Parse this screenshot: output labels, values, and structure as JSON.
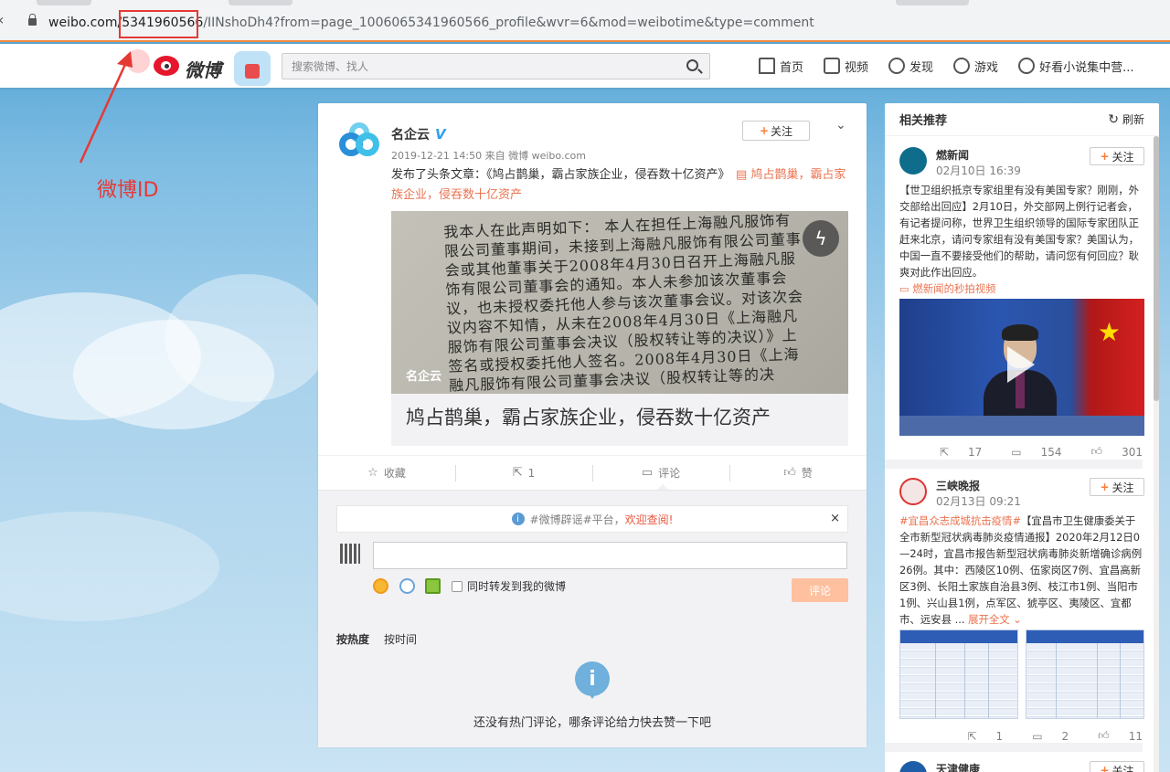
{
  "browser": {
    "url_host": "weibo.com/",
    "url_id": "5341960566",
    "url_rest": "/IINshoDh4?from=page_1006065341960566_profile&wvr=6&mod=weibotime&type=comment"
  },
  "annotation": {
    "label": "微博ID",
    "color": "#e53935"
  },
  "nav": {
    "logo_text": "微博",
    "search_placeholder": "搜索微博、找人",
    "items": [
      {
        "label": "首页",
        "icon": "home-icon"
      },
      {
        "label": "视频",
        "icon": "video-icon"
      },
      {
        "label": "发现",
        "icon": "compass-icon"
      },
      {
        "label": "游戏",
        "icon": "gamepad-icon"
      },
      {
        "label": "好看小说集中营...",
        "icon": "user-icon"
      }
    ]
  },
  "post": {
    "author": "名企云",
    "verified_badge": "V",
    "time_source": "2019-12-21 14:50 来自 微博 weibo.com",
    "follow_label": "关注",
    "text": "发布了头条文章：《鸠占鹊巢，霸占家族企业，侵吞数十亿资产》",
    "link_text": "鸠占鹊巢，霸占家族企业，侵吞数十亿资产",
    "image_doc_text": "我本人在此声明如下：\n本人在担任上海融凡服饰有限公司董事期间，未接到上海融凡服饰有限公司董事会或其他董事关于2008年4月30日召开上海融凡服饰有限公司董事会的通知。本人未参加该次董事会议，也未授权委托他人参与该次董事会议。对该次会议内容不知情，从未在2008年4月30日《上海融凡服饰有限公司董事会决议（股权转让等的决议）》上签名或授权委托他人签名。2008年4月30日《上海融凡服饰有限公司董事会决议（股权转让等的决",
    "image_brand": "名企云",
    "article_title": "鸠占鹊巢，霸占家族企业，侵吞数十亿资产",
    "actions": [
      {
        "label": "收藏",
        "icon": "star-icon"
      },
      {
        "label": "1",
        "icon": "share-icon"
      },
      {
        "label": "评论",
        "icon": "comment-icon"
      },
      {
        "label": "赞",
        "icon": "like-icon"
      }
    ]
  },
  "comments": {
    "rumor_prefix": "#微博辟谣#平台，",
    "rumor_link": "欢迎查阅!",
    "close": "×",
    "input_value": "",
    "forward_label": "同时转发到我的微博",
    "submit_label": "评论",
    "sort": [
      "按热度",
      "按时间"
    ],
    "empty_text": "还没有热门评论，哪条评论给力快去赞一下吧"
  },
  "sidebar": {
    "title": "相关推荐",
    "refresh_label": "刷新",
    "feeds": [
      {
        "name": "燃新闻",
        "time": "02月10日 16:39",
        "follow": "关注",
        "text": "【世卫组织抵京专家组里有没有美国专家？刚刚，外交部给出回应】2月10日，外交部网上例行记者会，有记者提问称，世界卫生组织领导的国际专家团队正赶来北京，请问专家组有没有美国专家？美国认为，中国一直不要接受他们的帮助，请问您有何回应？耿爽对此作出回应。",
        "video_link": "燃新闻的秒拍视频",
        "reposts": "17",
        "comments": "154",
        "likes": "301"
      },
      {
        "name": "三峡晚报",
        "time": "02月13日 09:21",
        "follow": "关注",
        "hashtag": "#宜昌众志成城抗击疫情#",
        "text": "【宜昌市卫生健康委关于全市新型冠状病毒肺炎疫情通报】2020年2月12日0—24时，宜昌市报告新型冠状病毒肺炎新增确诊病例26例。其中：西陵区10例、伍家岗区7例、宜昌高新区3例、长阳土家族自治县3例、枝江市1例、当阳市1例、兴山县1例，点军区、猇亭区、夷陵区、宜都市、远安县 ...",
        "expand": "展开全文",
        "reposts": "1",
        "comments": "2",
        "likes": "11"
      },
      {
        "name": "天津健康",
        "follow": "关注"
      }
    ]
  }
}
